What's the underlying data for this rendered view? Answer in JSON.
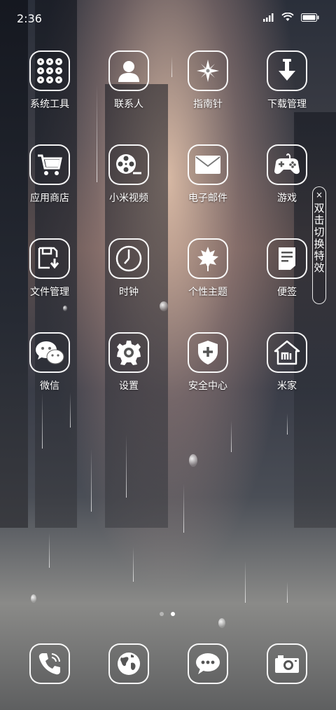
{
  "statusbar": {
    "time": "2:36",
    "icons": [
      "signal-icon",
      "wifi-icon",
      "battery-icon"
    ]
  },
  "apps": [
    {
      "label": "系统工具",
      "icon": "folder-grid-icon"
    },
    {
      "label": "联系人",
      "icon": "contact-person-icon"
    },
    {
      "label": "指南针",
      "icon": "compass-icon"
    },
    {
      "label": "下载管理",
      "icon": "download-icon"
    },
    {
      "label": "应用商店",
      "icon": "shopping-cart-icon"
    },
    {
      "label": "小米视频",
      "icon": "film-reel-icon"
    },
    {
      "label": "电子邮件",
      "icon": "envelope-icon"
    },
    {
      "label": "游戏",
      "icon": "gamepad-icon"
    },
    {
      "label": "文件管理",
      "icon": "file-save-icon"
    },
    {
      "label": "时钟",
      "icon": "clock-icon"
    },
    {
      "label": "个性主题",
      "icon": "leaf-icon"
    },
    {
      "label": "便签",
      "icon": "note-icon"
    },
    {
      "label": "微信",
      "icon": "wechat-icon"
    },
    {
      "label": "设置",
      "icon": "gear-icon"
    },
    {
      "label": "安全中心",
      "icon": "shield-icon"
    },
    {
      "label": "米家",
      "icon": "mi-home-icon"
    }
  ],
  "effect_toggle": {
    "close": "×",
    "text": "双击切换特效"
  },
  "pages": {
    "count": 2,
    "active": 2
  },
  "dock": [
    {
      "icon": "phone-icon"
    },
    {
      "icon": "globe-icon"
    },
    {
      "icon": "message-icon"
    },
    {
      "icon": "camera-icon"
    }
  ]
}
